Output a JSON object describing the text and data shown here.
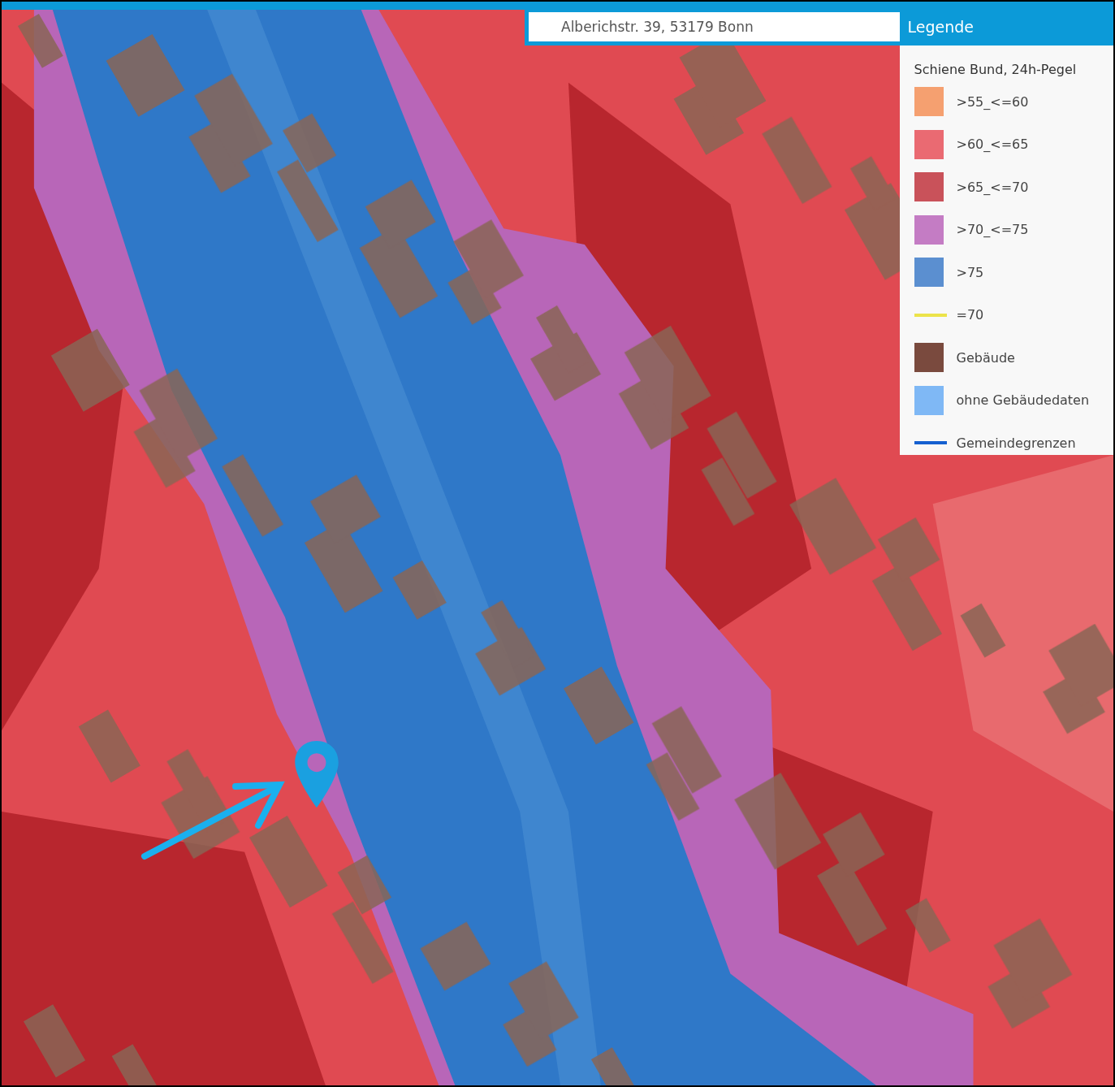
{
  "search": {
    "value": "Alberichstr. 39, 53179 Bonn"
  },
  "legend": {
    "title": "Legende",
    "subtitle": "Schiene Bund, 24h-Pegel",
    "items": [
      {
        "kind": "swatch",
        "label": ">55_<=60",
        "color": "#f5a070"
      },
      {
        "kind": "swatch",
        "label": ">60_<=65",
        "color": "#ea6a72"
      },
      {
        "kind": "swatch",
        "label": ">65_<=70",
        "color": "#c9525a"
      },
      {
        "kind": "swatch",
        "label": ">70_<=75",
        "color": "#c47cc4"
      },
      {
        "kind": "swatch",
        "label": ">75",
        "color": "#5b8fd0"
      },
      {
        "kind": "line",
        "label": "=70",
        "color": "#ece34a"
      },
      {
        "kind": "swatch",
        "label": "Gebäude",
        "color": "#7a4a3e"
      },
      {
        "kind": "swatch",
        "label": "ohne Gebäudedaten",
        "color": "#7fb8f5"
      },
      {
        "kind": "line",
        "label": "Gemeindegrenzen",
        "color": "#1560d0"
      }
    ]
  }
}
